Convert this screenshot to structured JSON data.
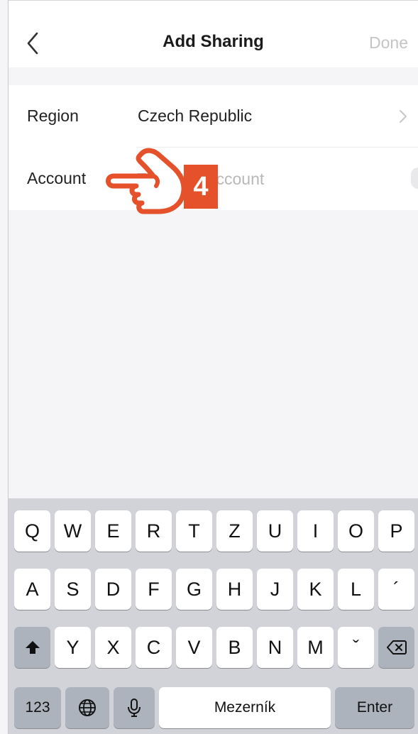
{
  "navbar": {
    "title": "Add Sharing",
    "done_label": "Done"
  },
  "form": {
    "region": {
      "label": "Region",
      "value": "Czech Republic"
    },
    "account": {
      "label": "Account",
      "placeholder": "Enter the account",
      "value": ""
    }
  },
  "annotation": {
    "step_number": "4"
  },
  "keyboard": {
    "row1": [
      "Q",
      "W",
      "E",
      "R",
      "T",
      "Z",
      "U",
      "I",
      "O",
      "P"
    ],
    "row2": [
      "A",
      "S",
      "D",
      "F",
      "G",
      "H",
      "J",
      "K",
      "L",
      "´"
    ],
    "row3": [
      "Y",
      "X",
      "C",
      "V",
      "B",
      "N",
      "M",
      "ˇ"
    ],
    "numbers_label": "123",
    "space_label": "Mezerník",
    "enter_label": "Enter"
  },
  "colors": {
    "accent": "#e4512a",
    "keyboard_bg": "#d1d3d9",
    "done_disabled": "#c4c4c4"
  }
}
